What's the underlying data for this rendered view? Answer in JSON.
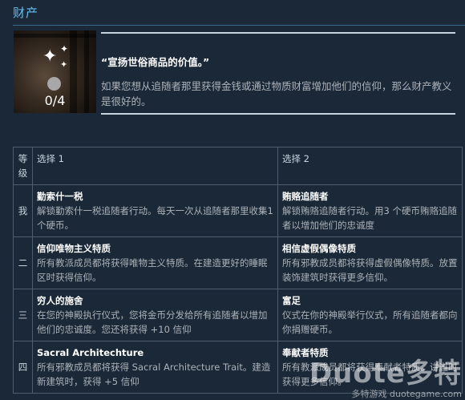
{
  "section": {
    "title": "财产"
  },
  "card": {
    "count": "0/4",
    "quote": "“宣扬世俗商品的价值。”",
    "description": "如果您想从追随者那里获得金钱或通过物质财富增加他们的信仰，那么财产教义是很好的。"
  },
  "table": {
    "headers": {
      "level": "等级",
      "choice1": "选择 1",
      "choice2": "选择 2"
    },
    "rows": [
      {
        "level": "我",
        "c1_name": "勤索什一税",
        "c1_desc": "解锁勤索什一税追随者行动。每天一次从追随者那里收集1 个硬币。",
        "c2_name": "贿赂追随者",
        "c2_desc": "解锁贿赂追随者行动。用3 个硬币贿赂追随者以增加他们的忠诚度"
      },
      {
        "level": "二",
        "c1_name": "信仰唯物主义特质",
        "c1_desc": "所有教派成员都将获得唯物主义特质。在建造更好的睡眠区时获得信仰。",
        "c2_name": "相信虚假偶像特质",
        "c2_desc": "所有邪教成员都将获得虚假偶像特质。放置装饰建筑时获得更多信仰。"
      },
      {
        "level": "三",
        "c1_name": "穷人的施舍",
        "c1_desc": "在您的神殿执行仪式，您将金币分发给所有追随者以增加他们的忠诚度。您还将获得 +10 信仰",
        "c2_name": "富足",
        "c2_desc": "仪式在你的神殿举行仪式，所有追随者都向你捐赠硬币。"
      },
      {
        "level": "四",
        "c1_name": "Sacral Architechture",
        "c1_desc": "所有邪教成员都将获得 Sacral Architecture Trait。建造新建筑时，获得 +5 信仰",
        "c2_name": "奉献者特质",
        "c2_desc": "所有教派成员都将获得奉献者特质。讲道时获得更多信仰。"
      }
    ]
  },
  "watermark": {
    "brand": "Duote多特",
    "sub": "多特游戏 duotegame.com"
  },
  "colors": {
    "background": "#1b2838",
    "title": "#66c0f4",
    "text": "#acb2b8",
    "heading": "#ffffff"
  },
  "icons": {
    "sparkle": "sparkle-icon",
    "token": "coin-dot-icon"
  }
}
